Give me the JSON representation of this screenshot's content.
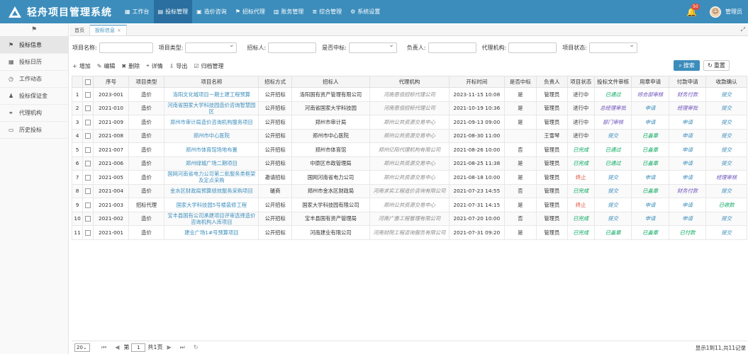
{
  "app": {
    "title": "轻舟项目管理系统",
    "nav": [
      {
        "label": "工作台",
        "icon": "dashboard-icon"
      },
      {
        "label": "投标管理",
        "icon": "clipboard-icon",
        "active": true
      },
      {
        "label": "造价咨询",
        "icon": "calculator-icon"
      },
      {
        "label": "招标代理",
        "icon": "flag-icon"
      },
      {
        "label": "账务管理",
        "icon": "ledger-icon"
      },
      {
        "label": "综合管理",
        "icon": "server-icon"
      },
      {
        "label": "系统设置",
        "icon": "gear-icon"
      }
    ],
    "notification_count": "50",
    "user": "管理员"
  },
  "sidebar": {
    "items": [
      {
        "label": "投标信息",
        "icon": "flag-icon",
        "active": true
      },
      {
        "label": "投标日历",
        "icon": "calendar-icon"
      },
      {
        "label": "工作动态",
        "icon": "clock-icon"
      },
      {
        "label": "投标保证金",
        "icon": "stamp-icon"
      },
      {
        "label": "代理机构",
        "icon": "link-icon"
      },
      {
        "label": "历史投标",
        "icon": "folder-icon"
      }
    ]
  },
  "tabs": [
    {
      "label": "首页"
    },
    {
      "label": "投标信息",
      "active": true,
      "close": "×"
    }
  ],
  "filters": {
    "name_label": "项目名称:",
    "type_label": "项目类型:",
    "tenderer_label": "招标人:",
    "won_label": "是否中标:",
    "owner_label": "负责人:",
    "agency_label": "代理机构:",
    "status_label": "项目状态:"
  },
  "toolbar": {
    "add": "增加",
    "edit": "编辑",
    "delete": "删除",
    "detail": "详情",
    "export": "导出",
    "archive": "归档管理",
    "search": "搜索",
    "reset": "重置"
  },
  "table": {
    "headers": [
      "",
      "",
      "序号",
      "项目类型",
      "项目名称",
      "招标方式",
      "招标人",
      "代理机构",
      "开标时间",
      "是否中标",
      "负责人",
      "项目状态",
      "投标文件审核",
      "用章申请",
      "付款申请",
      "收款确认"
    ],
    "rows": [
      {
        "n": "1",
        "no": "2023-001",
        "type": "造价",
        "name": "洛阳文化城项目一期土建工程预算",
        "method": "公开招标",
        "tenderer": "洛阳国有资产管理有限公司",
        "agency": "河南恩倍招标代理公司",
        "time": "2023-11-15 10:08",
        "won": "是",
        "owner": "管理员",
        "status": "进行中",
        "audit": "已通过",
        "seal": "综合部审核",
        "pay": "财务付款",
        "recv": "提交"
      },
      {
        "n": "2",
        "no": "2021-010",
        "type": "造价",
        "name": "河南省国家大学科技园造价咨询智慧园区",
        "method": "公开招标",
        "tenderer": "河南省国家大学科技园",
        "agency": "河南恩倍招标代理公司",
        "time": "2021-10-19 10:36",
        "won": "是",
        "owner": "管理员",
        "status": "进行中",
        "audit": "总经理审批",
        "seal": "申请",
        "pay": "经理审批",
        "recv": "提交"
      },
      {
        "n": "3",
        "no": "2021-009",
        "type": "造价",
        "name": "郑州市审计局造价咨询机构服务项目",
        "method": "公开招标",
        "tenderer": "郑州市审计局",
        "agency": "郑州公共资源交易中心",
        "time": "2021-09-13 09:00",
        "won": "是",
        "owner": "管理员",
        "status": "进行中",
        "audit": "部门审核",
        "seal": "申请",
        "pay": "申请",
        "recv": "提交"
      },
      {
        "n": "4",
        "no": "2021-008",
        "type": "造价",
        "name": "郑州市中心医院",
        "method": "公开招标",
        "tenderer": "郑州市中心医院",
        "agency": "郑州公共资源交易中心",
        "time": "2021-08-30 11:00",
        "won": "",
        "owner": "王雪琴",
        "status": "进行中",
        "audit": "提交",
        "seal": "已盖章",
        "pay": "申请",
        "recv": "提交"
      },
      {
        "n": "5",
        "no": "2021-007",
        "type": "造价",
        "name": "郑州市体育馆场地布置",
        "method": "公开招标",
        "tenderer": "郑州市体育馆",
        "agency": "郑州亿阳代理机构有限公司",
        "time": "2021-08-26 10:00",
        "won": "否",
        "owner": "管理员",
        "status": "已完成",
        "audit": "已通过",
        "seal": "已盖章",
        "pay": "申请",
        "recv": "提交"
      },
      {
        "n": "6",
        "no": "2021-006",
        "type": "造价",
        "name": "郑州绿城广场二期项目",
        "method": "公开招标",
        "tenderer": "中原区市政管理局",
        "agency": "郑州公共资源交易中心",
        "time": "2021-08-25 11:38",
        "won": "是",
        "owner": "管理员",
        "status": "已完成",
        "audit": "已通过",
        "seal": "已盖章",
        "pay": "申请",
        "recv": "提交"
      },
      {
        "n": "7",
        "no": "2021-005",
        "type": "造价",
        "name": "国网河南省电力公司第二批服务类框架及定点采购",
        "method": "邀请招标",
        "tenderer": "国网河南省电力公司",
        "agency": "郑州公共资源交易中心",
        "time": "2021-08-18 10:00",
        "won": "是",
        "owner": "管理员",
        "status": "终止",
        "audit": "提交",
        "seal": "申请",
        "pay": "申请",
        "recv": "经理审核"
      },
      {
        "n": "8",
        "no": "2021-004",
        "type": "造价",
        "name": "金水区财政局预算绩效服务采购项目",
        "method": "磋商",
        "tenderer": "郑州市金水区财政局",
        "agency": "河南求实工程造价咨询有限公司",
        "time": "2021-07-23 14:55",
        "won": "否",
        "owner": "管理员",
        "status": "已完成",
        "audit": "提交",
        "seal": "已盖章",
        "pay": "财务付款",
        "recv": "提交"
      },
      {
        "n": "9",
        "no": "2021-003",
        "type": "招标代理",
        "name": "国家大学科技园5号楼装修工程",
        "method": "公开招标",
        "tenderer": "国家大学科技园有限公司",
        "agency": "郑州公共资源交易中心",
        "time": "2021-07-31 14:15",
        "won": "是",
        "owner": "管理员",
        "status": "终止",
        "audit": "提交",
        "seal": "申请",
        "pay": "申请",
        "recv": "已收款"
      },
      {
        "n": "10",
        "no": "2021-002",
        "type": "造价",
        "name": "宝丰县国有公司承建项目评审选择造价咨询机构入库项目",
        "method": "公开招标",
        "tenderer": "宝丰县国有资产管理局",
        "agency": "河南广惠工程管理有限公司",
        "time": "2021-07-20 10:00",
        "won": "否",
        "owner": "管理员",
        "status": "已完成",
        "audit": "提交",
        "seal": "申请",
        "pay": "申请",
        "recv": "提交"
      },
      {
        "n": "11",
        "no": "2021-001",
        "type": "造价",
        "name": "建业广场1#号预算项目",
        "method": "公开招标",
        "tenderer": "河南建业有限公司",
        "agency": "河南财院工程咨询服务有限公司",
        "time": "2021-07-31 09:20",
        "won": "是",
        "owner": "管理员",
        "status": "已完成",
        "audit": "已盖章",
        "seal": "已盖章",
        "pay": "已付款",
        "recv": "提交"
      }
    ]
  },
  "footer": {
    "page_size": "20",
    "page_label_pre": "第",
    "page": "1",
    "page_label_post": "共1页",
    "summary": "显示1到11,共11记录"
  }
}
